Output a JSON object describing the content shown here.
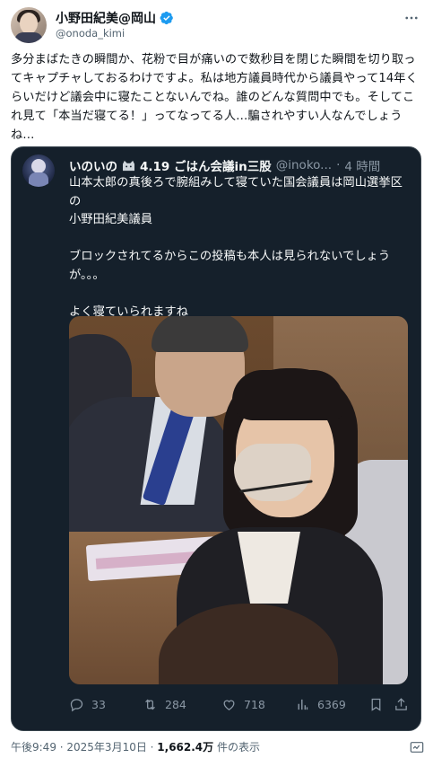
{
  "author": {
    "display_name": "小野田紀美@岡山",
    "handle": "@onoda_kimi"
  },
  "tweet": {
    "text": "多分まばたきの瞬間か、花粉で目が痛いので数秒目を閉じた瞬間を切り取ってキャプチャしておるわけですよ。私は地方議員時代から議員やって14年くらいだけど議会中に寝たことないんでね。誰のどんな質問中でも。そしてこれ見て「本当だ寝てる！」ってなってる人…騙されやすい人なんでしょうね…"
  },
  "quoted": {
    "name_part1": "いのいの",
    "name_part2": "4.19 ごはん会議in三股",
    "handle": "@inoko...",
    "dot": "·",
    "time": "4 時間",
    "text": "山本太郎の真後ろで腕組みして寝ていた国会議員は岡山選挙区の\n小野田紀美議員\n\nブロックされてるからこの投稿も本人は見られないでしょうが。。。\n\nよく寝ていられますね",
    "actions": {
      "replies": "33",
      "reposts": "284",
      "likes": "718",
      "views": "6369"
    }
  },
  "footer": {
    "timestamp": "午後9:49 · 2025年3月10日 · ",
    "views_count": "1,662.4万",
    "views_suffix": " 件の表示"
  },
  "icons": {
    "verified": "verified-badge-icon",
    "more": "more-icon",
    "reply": "reply-icon",
    "repost": "repost-icon",
    "like": "like-icon",
    "views": "views-icon",
    "bookmark": "bookmark-icon",
    "share": "share-icon",
    "grok": "grok-icon"
  },
  "colors": {
    "verified": "#1d9bf0",
    "quote_bg": "#15202b",
    "secondary_text": "#536471"
  }
}
